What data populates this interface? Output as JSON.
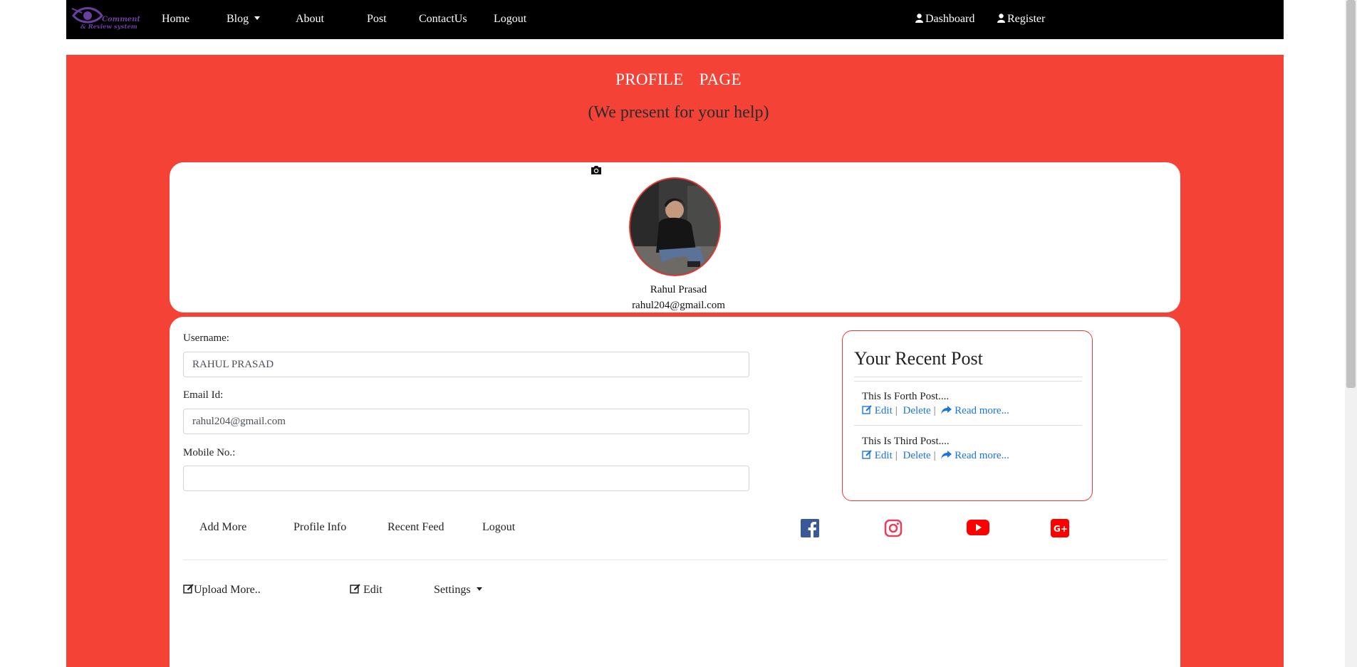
{
  "brand": {
    "line1": "Comment",
    "line2": "& Review system"
  },
  "nav": {
    "home": "Home",
    "blog": "Blog",
    "about": "About",
    "post": "Post",
    "contact": "ContactUs",
    "logout": "Logout",
    "dashboard": "Dashboard",
    "register": "Register"
  },
  "header": {
    "title": "PROFILE  PAGE",
    "subtitle": "(We present for your help)"
  },
  "profile": {
    "name": "Rahul Prasad",
    "email": "rahul204@gmail.com"
  },
  "form": {
    "username_label": "Username:",
    "username_value": "RAHUL PRASAD",
    "email_label": "Email Id:",
    "email_value": "rahul204@gmail.com",
    "mobile_label": "Mobile No.:",
    "mobile_value": ""
  },
  "recent": {
    "title": "Your Recent Post",
    "posts": [
      {
        "title": "This Is Forth Post....",
        "edit": "Edit",
        "delete": "Delete",
        "read": "Read more..."
      },
      {
        "title": "This Is Third Post....",
        "edit": "Edit",
        "delete": "Delete",
        "read": "Read more..."
      }
    ]
  },
  "tabs": {
    "add_more": "Add More",
    "profile_info": "Profile Info",
    "recent_feed": "Recent Feed",
    "logout": "Logout"
  },
  "actions": {
    "upload": "Upload More..",
    "edit": "Edit",
    "settings": "Settings"
  },
  "colors": {
    "banner": "#f44336",
    "link": "#1a73e8",
    "facebook": "#3b5998",
    "instagram": "#e4405f",
    "youtube": "#ff0000",
    "google_plus": "#dd4b39"
  },
  "icons": [
    "camera-icon",
    "user-icon",
    "edit-icon",
    "share-icon",
    "facebook-icon",
    "instagram-icon",
    "youtube-icon",
    "google-plus-icon"
  ]
}
